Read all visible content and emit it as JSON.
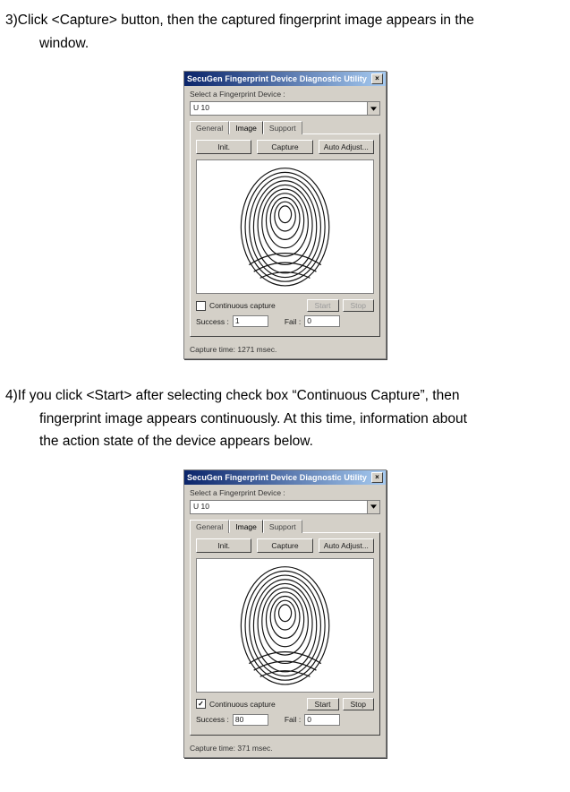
{
  "step3": {
    "line1": "3)Click <Capture> button, then the captured fingerprint image appears in the",
    "line2": "window."
  },
  "step4": {
    "line1": "4)If you click <Start> after selecting check box “Continuous Capture”, then",
    "line2": "fingerprint image appears continuously. At this time, information about",
    "line3": "the action state of the device appears below."
  },
  "dialog": {
    "title": "SecuGen Fingerprint Device Diagnostic Utility",
    "select_label": "Select a Fingerprint Device :",
    "dropdown_value": "U 10",
    "tabs": [
      "General",
      "Image",
      "Support"
    ],
    "active_tab": 1,
    "top_buttons": {
      "init": "Init.",
      "capture": "Capture",
      "auto": "Auto Adjust..."
    },
    "continuous_label": "Continuous capture",
    "start": "Start",
    "stop": "Stop",
    "success_label": "Success :",
    "fail_label": "Fail :"
  },
  "dlg1": {
    "continuous_checked": false,
    "start_enabled": false,
    "stop_enabled": false,
    "success_value": "1",
    "fail_value": "0",
    "footer": "Capture time: 1271 msec."
  },
  "dlg2": {
    "continuous_checked": true,
    "start_enabled": true,
    "stop_enabled": true,
    "success_value": "80",
    "fail_value": "0",
    "footer": "Capture time: 371 msec."
  }
}
